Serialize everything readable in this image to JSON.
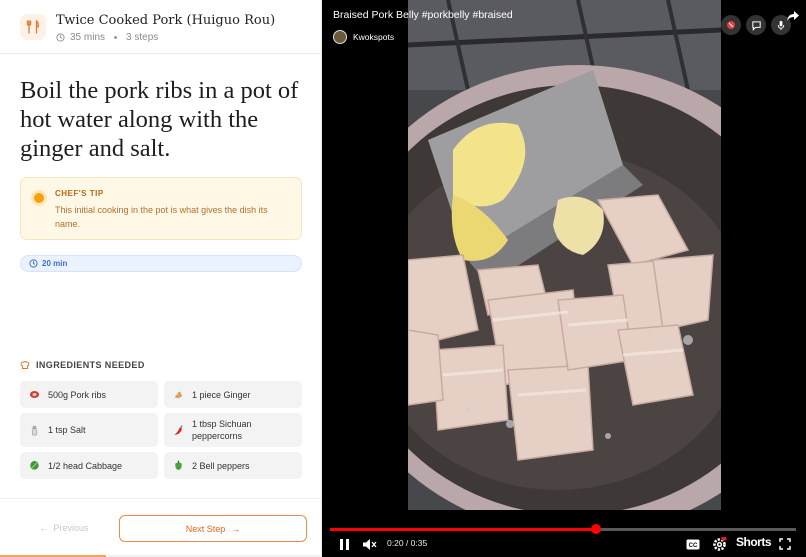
{
  "recipe": {
    "title": "Twice Cooked Pork (Huiguo Rou)",
    "duration": "35 mins",
    "steps": "3 steps"
  },
  "step": {
    "instruction": "Boil the pork ribs in a pot of hot water along with the ginger and salt."
  },
  "tip": {
    "label": "CHEF'S TIP",
    "text": "This initial cooking in the pot is what gives the dish its name."
  },
  "timer": {
    "label": "20 min"
  },
  "ingredients": {
    "heading": "INGREDIENTS NEEDED",
    "items": [
      {
        "label": "500g Pork ribs",
        "icon": "meat-icon"
      },
      {
        "label": "1 piece Ginger",
        "icon": "ginger-icon"
      },
      {
        "label": "1 tsp Salt",
        "icon": "salt-shaker-icon"
      },
      {
        "label": "1 tbsp Sichuan peppercorns",
        "icon": "chili-pepper-icon"
      },
      {
        "label": "1/2 head Cabbage",
        "icon": "cabbage-icon"
      },
      {
        "label": "2 Bell peppers",
        "icon": "bell-pepper-icon"
      }
    ]
  },
  "nav": {
    "previous": "Previous",
    "next": "Next Step"
  },
  "progress": {
    "fraction": 0.33
  },
  "video": {
    "title": "Braised Pork Belly #porkbelly #braised",
    "channel": "Kwokspots",
    "time": "0:20 / 0:35",
    "played_fraction": 0.57,
    "shorts_label": "Shorts"
  },
  "colors": {
    "accent": "#e06a20",
    "tip_bg": "#fff8e6",
    "timer_blue": "#3b6fcf",
    "youtube_red": "#ff0000"
  }
}
